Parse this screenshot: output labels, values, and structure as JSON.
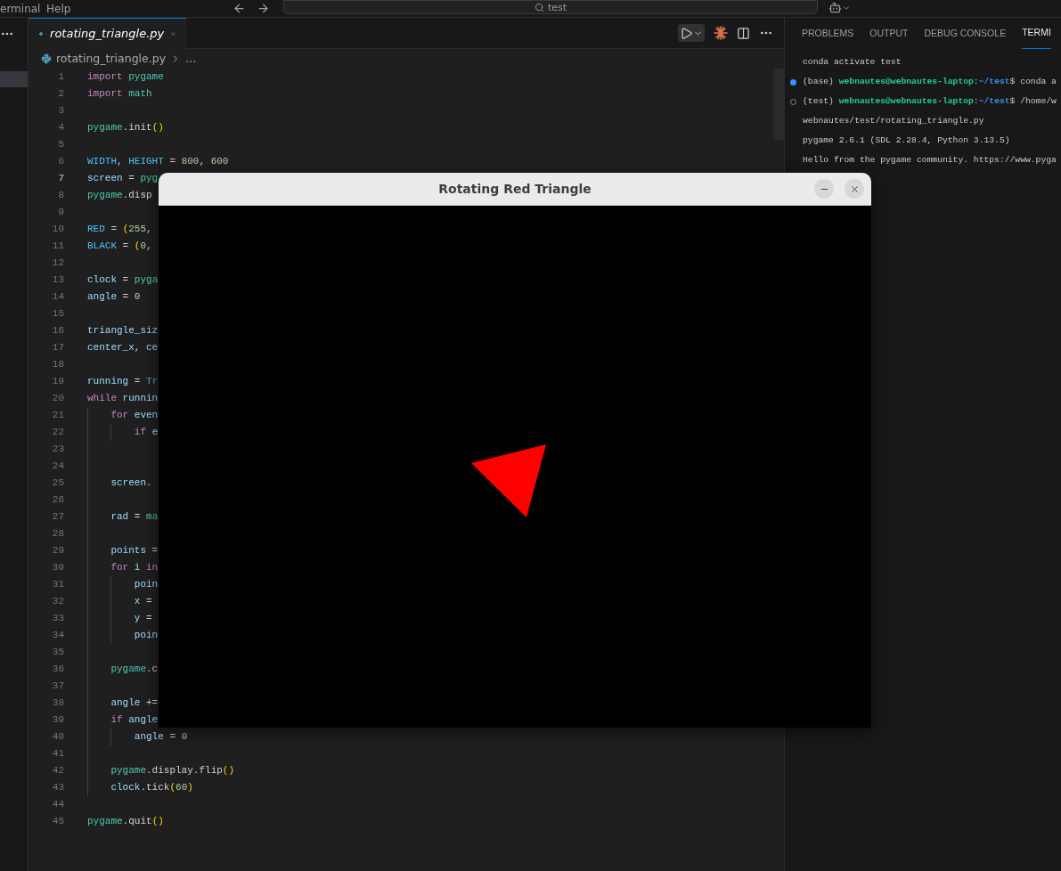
{
  "menu_bar": {
    "items": [
      "erminal",
      "Help"
    ],
    "search": {
      "value": "test"
    }
  },
  "editor": {
    "tabs": [
      {
        "label": "rotating_triangle.py",
        "selected": true,
        "preview": true
      }
    ],
    "breadcrumb": [
      "rotating_triangle.py",
      "…"
    ],
    "lines": [
      {
        "n": "1",
        "current": false,
        "segs": [
          {
            "kind": "kw",
            "text": "import "
          },
          {
            "kind": "mod",
            "text": "pygame"
          }
        ]
      },
      {
        "n": "2",
        "current": false,
        "segs": [
          {
            "kind": "kw",
            "text": "import "
          },
          {
            "kind": "mod",
            "text": "math"
          }
        ]
      },
      {
        "n": "3",
        "current": false
      },
      {
        "n": "4",
        "current": false,
        "segs": [
          {
            "kind": "mod",
            "text": "pygame"
          },
          {
            "kind": "p",
            "text": ".init"
          },
          {
            "kind": "br",
            "text": "()"
          }
        ]
      },
      {
        "n": "5",
        "current": false
      },
      {
        "n": "6",
        "current": false,
        "segs": [
          {
            "kind": "const",
            "text": "WIDTH"
          },
          {
            "kind": "p",
            "text": ", "
          },
          {
            "kind": "const",
            "text": "HEIGHT"
          },
          {
            "kind": "p",
            "text": " = "
          },
          {
            "kind": "num",
            "text": "800"
          },
          {
            "kind": "p",
            "text": ", "
          },
          {
            "kind": "num",
            "text": "600"
          }
        ]
      },
      {
        "n": "7",
        "current": true,
        "segs": [
          {
            "kind": "var",
            "text": "screen"
          },
          {
            "kind": "p",
            "text": " = "
          },
          {
            "kind": "mod",
            "text": "pyg"
          }
        ]
      },
      {
        "n": "8",
        "current": false,
        "segs": [
          {
            "kind": "mod",
            "text": "pygame"
          },
          {
            "kind": "p",
            "text": ".disp"
          }
        ]
      },
      {
        "n": "9",
        "current": false
      },
      {
        "n": "10",
        "current": false,
        "segs": [
          {
            "kind": "const",
            "text": "RED"
          },
          {
            "kind": "p",
            "text": " = "
          },
          {
            "kind": "br",
            "text": "("
          },
          {
            "kind": "num",
            "text": "255"
          },
          {
            "kind": "p",
            "text": ","
          }
        ]
      },
      {
        "n": "11",
        "current": false,
        "segs": [
          {
            "kind": "const",
            "text": "BLACK"
          },
          {
            "kind": "p",
            "text": " = "
          },
          {
            "kind": "br",
            "text": "("
          },
          {
            "kind": "num",
            "text": "0"
          },
          {
            "kind": "p",
            "text": ","
          }
        ]
      },
      {
        "n": "12",
        "current": false
      },
      {
        "n": "13",
        "current": false,
        "segs": [
          {
            "kind": "var",
            "text": "clock"
          },
          {
            "kind": "p",
            "text": " = "
          },
          {
            "kind": "mod",
            "text": "pyga"
          }
        ]
      },
      {
        "n": "14",
        "current": false,
        "segs": [
          {
            "kind": "var",
            "text": "angle"
          },
          {
            "kind": "p",
            "text": " = "
          },
          {
            "kind": "num",
            "text": "0"
          }
        ]
      },
      {
        "n": "15",
        "current": false
      },
      {
        "n": "16",
        "current": false,
        "segs": [
          {
            "kind": "var",
            "text": "triangle_siz"
          }
        ]
      },
      {
        "n": "17",
        "current": false,
        "segs": [
          {
            "kind": "var",
            "text": "center_x"
          },
          {
            "kind": "p",
            "text": ", "
          },
          {
            "kind": "var",
            "text": "ce"
          }
        ]
      },
      {
        "n": "18",
        "current": false
      },
      {
        "n": "19",
        "current": false,
        "segs": [
          {
            "kind": "var",
            "text": "running"
          },
          {
            "kind": "p",
            "text": " = "
          },
          {
            "kind": "bool",
            "text": "Tr"
          }
        ]
      },
      {
        "n": "20",
        "current": false,
        "segs": [
          {
            "kind": "kw",
            "text": "while "
          },
          {
            "kind": "var",
            "text": "runnin"
          }
        ]
      },
      {
        "n": "21",
        "current": false,
        "segs": [
          {
            "kind": "kw",
            "text": "    for "
          },
          {
            "kind": "var",
            "text": "even"
          }
        ]
      },
      {
        "n": "22",
        "current": false,
        "segs": [
          {
            "kind": "kw",
            "text": "        if "
          },
          {
            "kind": "var",
            "text": "e"
          }
        ]
      },
      {
        "n": "23",
        "current": false
      },
      {
        "n": "24",
        "current": false
      },
      {
        "n": "25",
        "current": false,
        "segs": [
          {
            "kind": "var",
            "text": "    screen"
          },
          {
            "kind": "p",
            "text": "."
          }
        ]
      },
      {
        "n": "26",
        "current": false
      },
      {
        "n": "27",
        "current": false,
        "segs": [
          {
            "kind": "var",
            "text": "    rad"
          },
          {
            "kind": "p",
            "text": " = "
          },
          {
            "kind": "mod",
            "text": "ma"
          }
        ]
      },
      {
        "n": "28",
        "current": false
      },
      {
        "n": "29",
        "current": false,
        "segs": [
          {
            "kind": "var",
            "text": "    points"
          },
          {
            "kind": "p",
            "text": " ="
          }
        ]
      },
      {
        "n": "30",
        "current": false,
        "segs": [
          {
            "kind": "kw",
            "text": "    for "
          },
          {
            "kind": "var",
            "text": "i"
          },
          {
            "kind": "kw",
            "text": " in"
          }
        ]
      },
      {
        "n": "31",
        "current": false,
        "segs": [
          {
            "kind": "var",
            "text": "        poin"
          }
        ]
      },
      {
        "n": "32",
        "current": false,
        "segs": [
          {
            "kind": "var",
            "text": "        x"
          },
          {
            "kind": "p",
            "text": " ="
          }
        ]
      },
      {
        "n": "33",
        "current": false,
        "segs": [
          {
            "kind": "var",
            "text": "        y"
          },
          {
            "kind": "p",
            "text": " ="
          }
        ]
      },
      {
        "n": "34",
        "current": false,
        "segs": [
          {
            "kind": "var",
            "text": "        poin"
          }
        ]
      },
      {
        "n": "35",
        "current": false
      },
      {
        "n": "36",
        "current": false,
        "segs": [
          {
            "kind": "mod",
            "text": "    pygame"
          },
          {
            "kind": "p",
            "text": ".c"
          }
        ]
      },
      {
        "n": "37",
        "current": false
      },
      {
        "n": "38",
        "current": false,
        "segs": [
          {
            "kind": "var",
            "text": "    angle"
          },
          {
            "kind": "p",
            "text": " +="
          }
        ]
      },
      {
        "n": "39",
        "current": false,
        "segs": [
          {
            "kind": "kw",
            "text": "    if "
          },
          {
            "kind": "var",
            "text": "angle"
          }
        ]
      },
      {
        "n": "40",
        "current": false,
        "segs": [
          {
            "kind": "var",
            "text": "        angle"
          },
          {
            "kind": "p",
            "text": " = "
          },
          {
            "kind": "num",
            "text": "0"
          }
        ]
      },
      {
        "n": "41",
        "current": false
      },
      {
        "n": "42",
        "current": false,
        "segs": [
          {
            "kind": "mod",
            "text": "    pygame"
          },
          {
            "kind": "p",
            "text": ".display.flip"
          },
          {
            "kind": "br",
            "text": "()"
          }
        ]
      },
      {
        "n": "43",
        "current": false,
        "segs": [
          {
            "kind": "var",
            "text": "    clock"
          },
          {
            "kind": "p",
            "text": ".tick"
          },
          {
            "kind": "br",
            "text": "("
          },
          {
            "kind": "num",
            "text": "60"
          },
          {
            "kind": "br",
            "text": ")"
          }
        ]
      },
      {
        "n": "44",
        "current": false
      },
      {
        "n": "45",
        "current": false,
        "segs": [
          {
            "kind": "mod",
            "text": "pygame"
          },
          {
            "kind": "p",
            "text": ".quit"
          },
          {
            "kind": "br",
            "text": "()"
          }
        ]
      }
    ]
  },
  "panel": {
    "tabs": [
      {
        "label": "PROBLEMS",
        "selected": false
      },
      {
        "label": "OUTPUT",
        "selected": false
      },
      {
        "label": "DEBUG CONSOLE",
        "selected": false
      },
      {
        "label": "TERMI",
        "selected": true
      }
    ],
    "terminal": [
      {
        "kind": "output",
        "segs": [
          {
            "kind": "o",
            "text": "conda activate test"
          }
        ]
      },
      {
        "kind": "command_done",
        "segs": [
          {
            "kind": "o",
            "text": "(base) "
          },
          {
            "kind": "user",
            "text": "webnautes@webnautes-laptop"
          },
          {
            "kind": "o",
            "text": ":"
          },
          {
            "kind": "path",
            "text": "~/test"
          },
          {
            "kind": "o",
            "text": "$ conda a"
          }
        ]
      },
      {
        "kind": "command_running",
        "segs": [
          {
            "kind": "o",
            "text": "(test) "
          },
          {
            "kind": "user",
            "text": "webnautes@webnautes-laptop"
          },
          {
            "kind": "o",
            "text": ":"
          },
          {
            "kind": "path",
            "text": "~/test"
          },
          {
            "kind": "o",
            "text": "$ /home/w"
          }
        ]
      },
      {
        "kind": "output",
        "segs": [
          {
            "kind": "o",
            "text": "webnautes/test/rotating_triangle.py"
          }
        ]
      },
      {
        "kind": "output",
        "segs": [
          {
            "kind": "o",
            "text": "pygame 2.6.1 (SDL 2.28.4, Python 3.13.5)"
          }
        ]
      },
      {
        "kind": "output",
        "segs": [
          {
            "kind": "o",
            "text": "Hello from the pygame community. https://www.pyga"
          }
        ]
      }
    ]
  },
  "app_window": {
    "title": "Rotating Red Triangle"
  }
}
